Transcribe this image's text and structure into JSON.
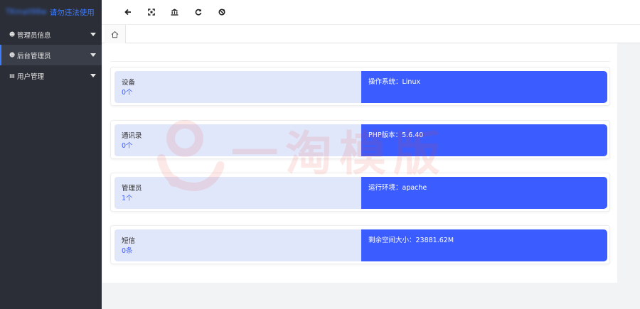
{
  "sidebar": {
    "brand_blurred": "TKmall98w",
    "brand_text": "请勿违法使用",
    "items": [
      {
        "icon": "user-icon",
        "label": "管理员信息"
      },
      {
        "icon": "user-icon",
        "label": "后台管理员",
        "active": true
      },
      {
        "icon": "id-card-icon",
        "label": "用户管理"
      }
    ]
  },
  "toolbar": {
    "buttons": [
      {
        "name": "back-button",
        "glyph": "←"
      },
      {
        "name": "fullscreen-button",
        "glyph": "⛶"
      },
      {
        "name": "bank-button",
        "glyph": "🏛"
      },
      {
        "name": "refresh-button",
        "glyph": "⟳"
      },
      {
        "name": "clear-cache-button",
        "glyph": "✱"
      }
    ]
  },
  "tabs": {
    "home_glyph": "⌂"
  },
  "cards": [
    {
      "name": "设备",
      "count": "0个",
      "info": "操作系统：Linux"
    },
    {
      "name": "通讯录",
      "count": "0个",
      "info": "PHP版本：5.6.40"
    },
    {
      "name": "管理员",
      "count": "1个",
      "info": "运行环境：apache"
    },
    {
      "name": "短信",
      "count": "0条",
      "info": "剩余空间大小：23881.62M"
    }
  ],
  "watermark": {
    "text": "一淘模版"
  },
  "colors": {
    "sidebar_bg": "#2b2e36",
    "accent": "#3b5cff",
    "card_left_bg": "#e1e7fb",
    "watermark": "#e84b3c"
  }
}
